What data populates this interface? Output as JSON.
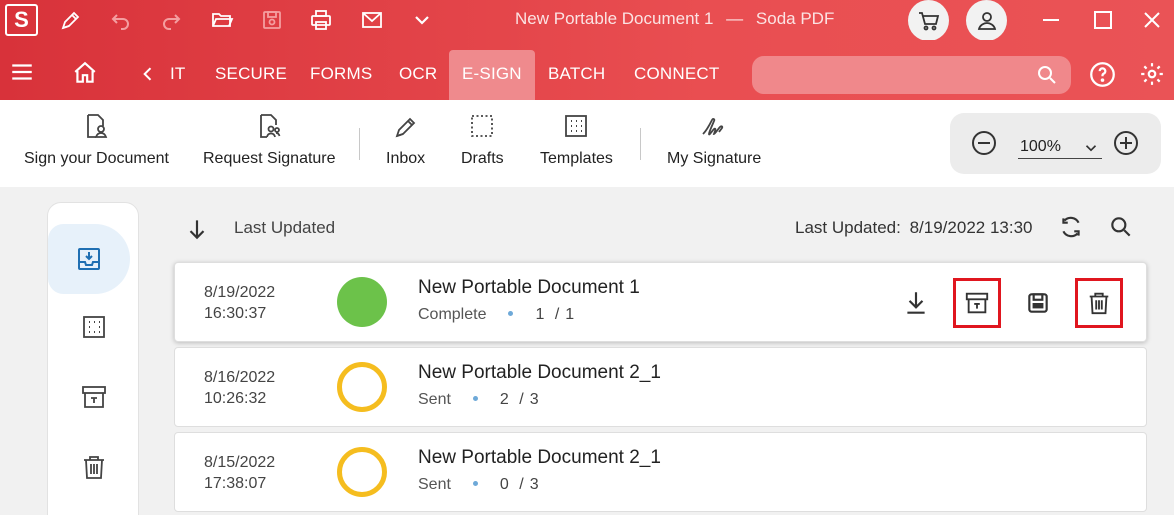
{
  "window": {
    "logo_letter": "S",
    "document_title": "New Portable Document 1",
    "separator": "—",
    "app_name": "Soda PDF"
  },
  "menu": {
    "tabs": [
      {
        "label": "IT",
        "active": false
      },
      {
        "label": "SECURE",
        "active": false
      },
      {
        "label": "FORMS",
        "active": false
      },
      {
        "label": "OCR",
        "active": false
      },
      {
        "label": "E-SIGN",
        "active": true
      },
      {
        "label": "BATCH",
        "active": false
      },
      {
        "label": "CONNECT",
        "active": false
      }
    ],
    "search_placeholder": ""
  },
  "toolbar": {
    "tools": [
      {
        "label": "Sign your Document",
        "icon": "sign-document-icon"
      },
      {
        "label": "Request Signature",
        "icon": "request-signature-icon"
      },
      {
        "label": "Inbox",
        "icon": "inbox-pen-icon"
      },
      {
        "label": "Drafts",
        "icon": "drafts-icon"
      },
      {
        "label": "Templates",
        "icon": "templates-icon"
      },
      {
        "label": "My Signature",
        "icon": "signature-icon"
      }
    ],
    "zoom": "100%"
  },
  "list": {
    "sort_label": "Last Updated",
    "last_updated_label": "Last Updated:",
    "last_updated_value": "8/19/2022 13:30",
    "items": [
      {
        "date": "8/19/2022",
        "time": "16:30:37",
        "name": "New Portable Document 1",
        "status": "Complete",
        "signed": "1",
        "total": "1",
        "status_color": "#6cc24a"
      },
      {
        "date": "8/16/2022",
        "time": "10:26:32",
        "name": "New Portable Document 2_1",
        "status": "Sent",
        "signed": "2",
        "total": "3",
        "status_color": "#f5bd1f"
      },
      {
        "date": "8/15/2022",
        "time": "17:38:07",
        "name": "New Portable Document 2_1",
        "status": "Sent",
        "signed": "0",
        "total": "3",
        "status_color": "#f5bd1f"
      }
    ],
    "count_separator": "/"
  },
  "colors": {
    "brand": "#e0393f",
    "highlight": "#e0161f",
    "active_tab": "#ef8a8d"
  }
}
